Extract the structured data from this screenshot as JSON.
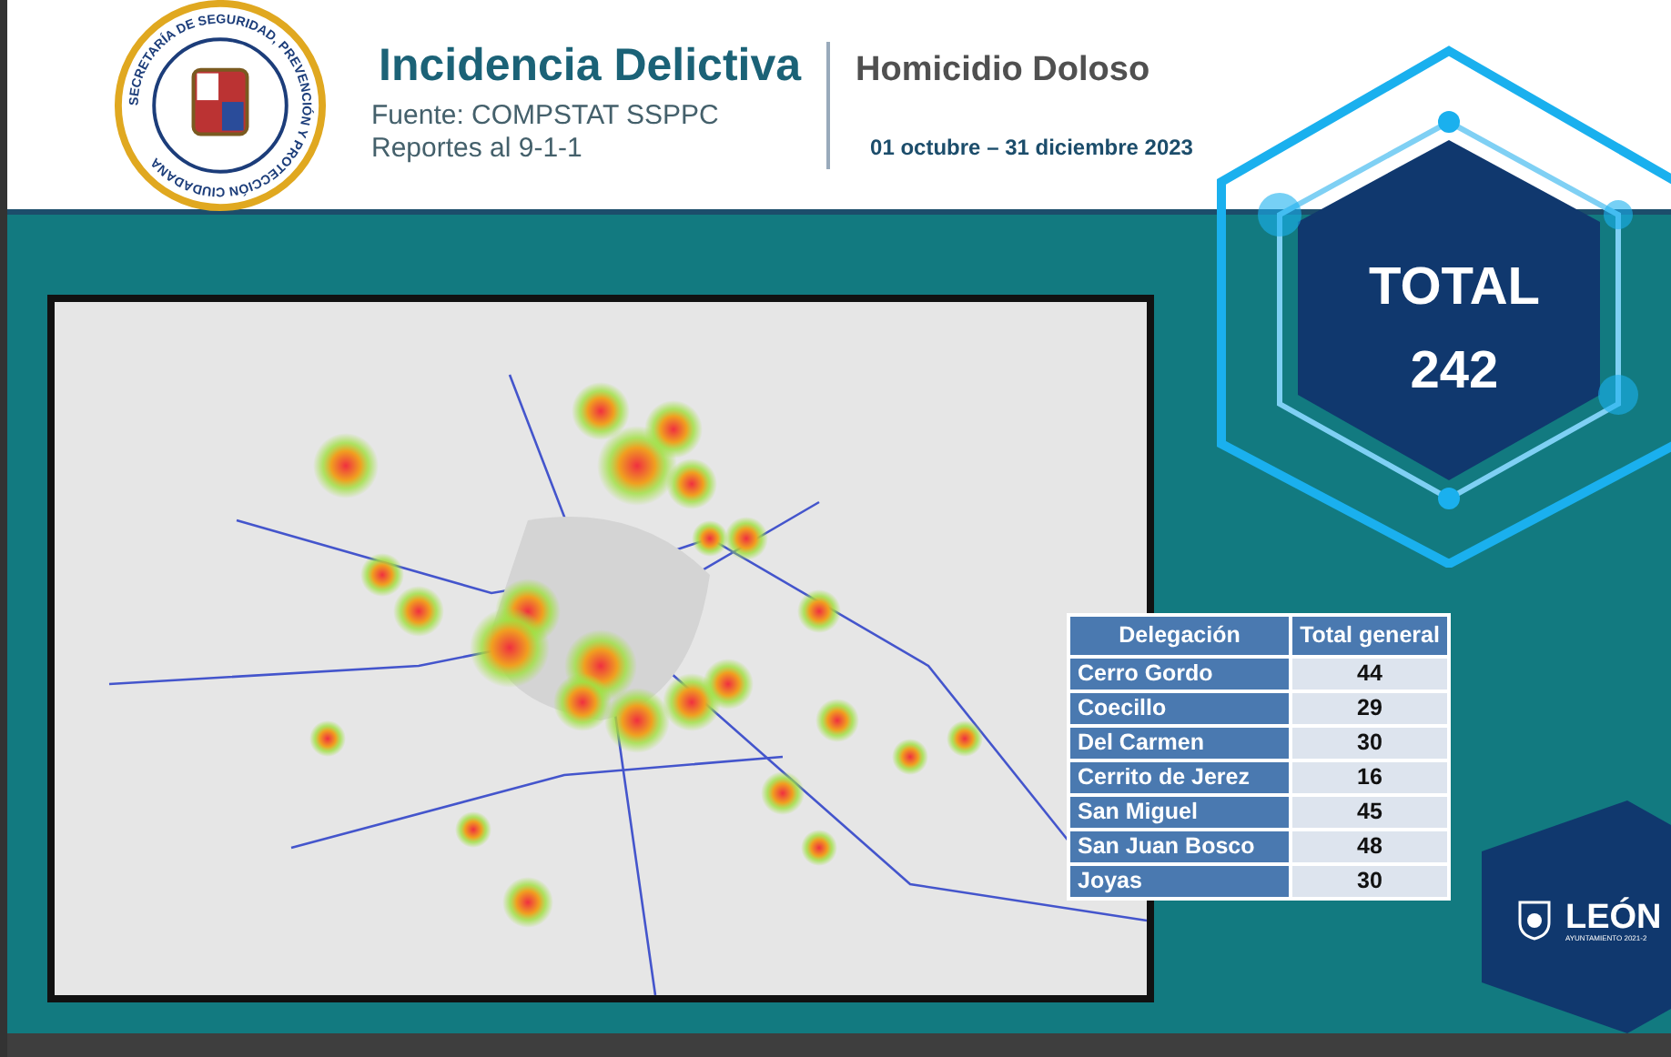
{
  "header": {
    "seal_text": "SECRETARÍA DE SEGURIDAD, PREVENCIÓN Y PROTECCIÓN CIUDADANA",
    "title": "Incidencia Delictiva",
    "source": "Fuente: COMPSTAT SSPPC",
    "reports": "Reportes al 9-1-1",
    "crime_type": "Homicidio Doloso",
    "date_range": "01 octubre – 31 diciembre 2023"
  },
  "total": {
    "label": "TOTAL",
    "value": "242"
  },
  "table": {
    "columns": [
      "Delegación",
      "Total general"
    ],
    "rows": [
      [
        "Cerro Gordo",
        "44"
      ],
      [
        "Coecillo",
        "29"
      ],
      [
        "Del Carmen",
        "30"
      ],
      [
        "Cerrito de Jerez",
        "16"
      ],
      [
        "San Miguel",
        "45"
      ],
      [
        "San Juan Bosco",
        "48"
      ],
      [
        "Joyas",
        "30"
      ]
    ]
  },
  "footer_logo": {
    "name": "LEÓN",
    "subtitle": "AYUNTAMIENTO 2021-2"
  }
}
